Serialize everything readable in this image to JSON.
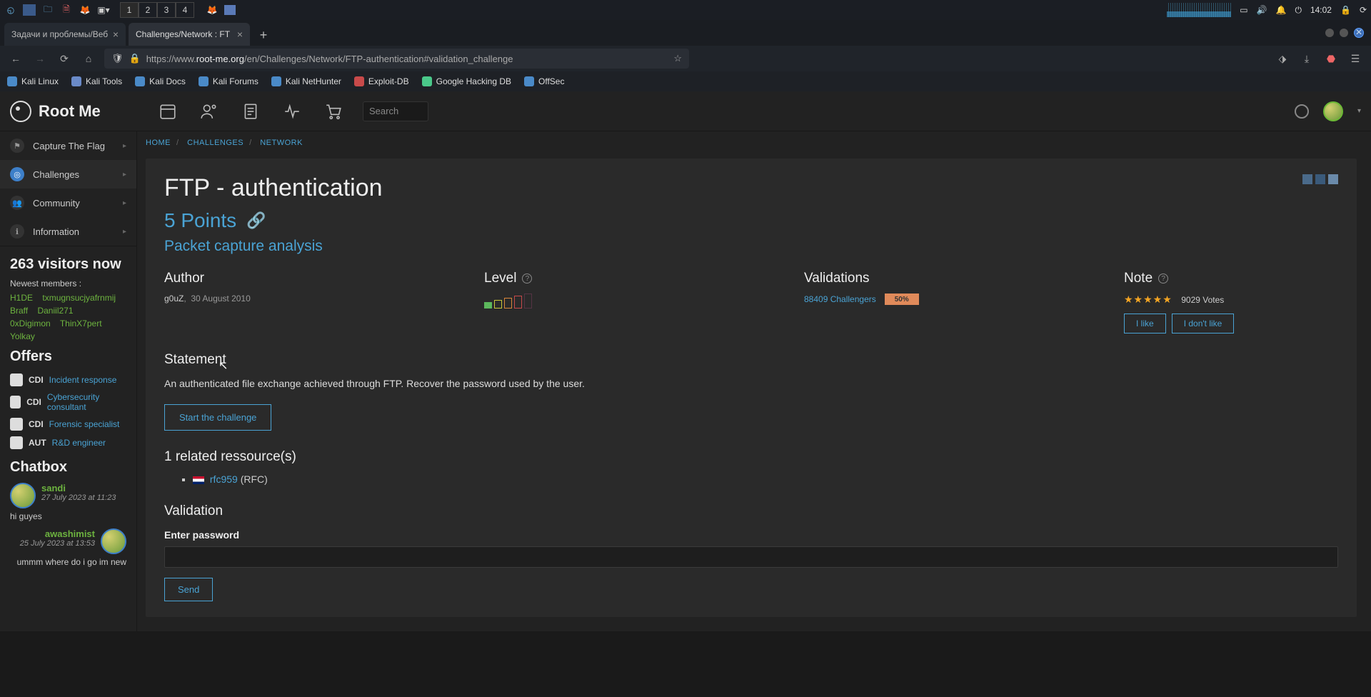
{
  "os": {
    "workspaces": [
      "1",
      "2",
      "3",
      "4"
    ],
    "time": "14:02"
  },
  "browser": {
    "tabs": [
      {
        "title": "Задачи и проблемы/Веб",
        "active": false
      },
      {
        "title": "Challenges/Network : FT",
        "active": true
      }
    ],
    "url_pre": "https://www.",
    "url_host": "root-me.org",
    "url_path": "/en/Challenges/Network/FTP-authentication#validation_challenge"
  },
  "bookmarks": [
    "Kali Linux",
    "Kali Tools",
    "Kali Docs",
    "Kali Forums",
    "Kali NetHunter",
    "Exploit-DB",
    "Google Hacking DB",
    "OffSec"
  ],
  "header": {
    "logo": "Root Me",
    "search_placeholder": "Search"
  },
  "sidebar": {
    "items": [
      {
        "label": "Capture The Flag",
        "icon": "flag"
      },
      {
        "label": "Challenges",
        "icon": "target",
        "active": true
      },
      {
        "label": "Community",
        "icon": "users"
      },
      {
        "label": "Information",
        "icon": "info"
      }
    ],
    "visitors_count": "263",
    "visitors_label": "visitors now",
    "newest_label": "Newest members :",
    "members": [
      "H1DE",
      "txmugnsucjyafrnmij",
      "Braff",
      "Daniil271",
      "0xDigimon",
      "ThinX7pert",
      "Yolkay"
    ],
    "offers_title": "Offers",
    "offers": [
      {
        "tag": "CDI",
        "text": "Incident response"
      },
      {
        "tag": "CDI",
        "text": "Cybersecurity consultant"
      },
      {
        "tag": "CDI",
        "text": "Forensic specialist"
      },
      {
        "tag": "AUT",
        "text": "R&D engineer"
      }
    ],
    "chatbox_title": "Chatbox",
    "chats": [
      {
        "name": "sandi",
        "time": "27 July 2023 at 11:23",
        "text": "hi guyes",
        "side": "left"
      },
      {
        "name": "awashimist",
        "time": "25 July 2023 at 13:53",
        "text": "ummm where do i go im new",
        "side": "right"
      }
    ]
  },
  "breadcrumb": [
    "HOME",
    "CHALLENGES",
    "NETWORK"
  ],
  "page": {
    "title": "FTP - authentication",
    "points": "5 Points",
    "subtitle": "Packet capture analysis",
    "author_h": "Author",
    "author_name": "g0uZ",
    "author_date": "30 August 2010",
    "level_h": "Level",
    "validations_h": "Validations",
    "validations_count": "88409 Challengers",
    "validations_perc": "50%",
    "note_h": "Note",
    "votes": "9029 Votes",
    "like": "I like",
    "dislike": "I don't like",
    "statement_h": "Statement",
    "statement": "An authenticated file exchange achieved through FTP. Recover the password used by the user.",
    "start": "Start the challenge",
    "resources_h": "1 related ressource(s)",
    "resource_link": "rfc959",
    "resource_suffix": " (RFC)",
    "validation_h": "Validation",
    "pw_label": "Enter password",
    "send": "Send"
  }
}
